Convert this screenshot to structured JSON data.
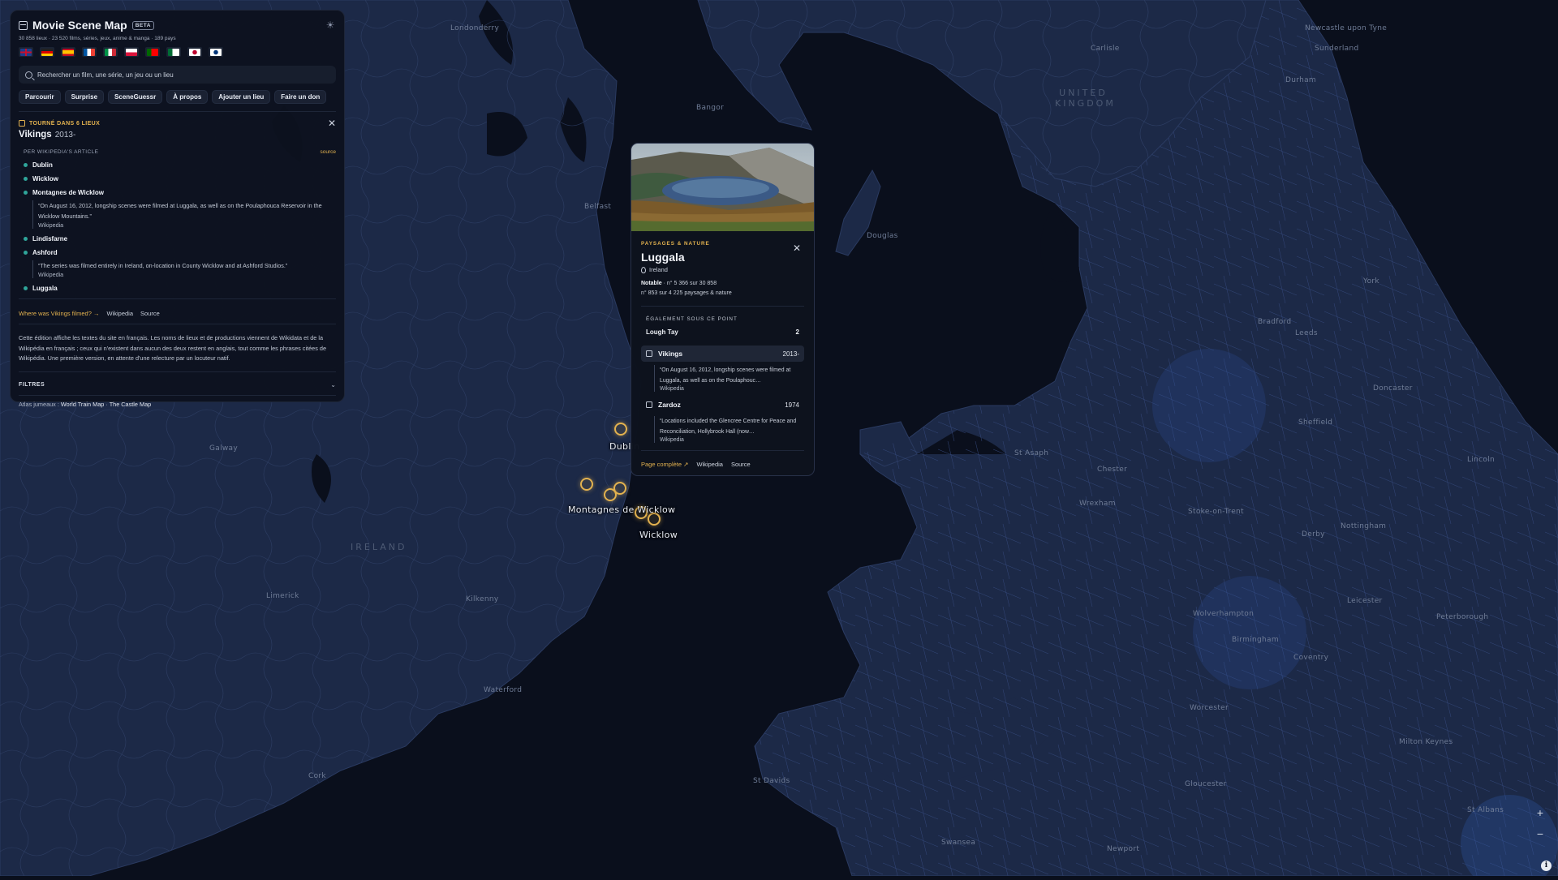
{
  "app": {
    "title": "Movie Scene Map",
    "badge": "BETA",
    "stats": "30 858 lieux · 23 520 films, séries, jeux, anime & manga · 189 pays",
    "theme_icon": "sun-icon"
  },
  "search": {
    "placeholder": "Rechercher un film, une série, un jeu ou un lieu"
  },
  "nav": [
    "Parcourir",
    "Surprise",
    "SceneGuessr",
    "À propos",
    "Ajouter un lieu",
    "Faire un don"
  ],
  "languages": [
    {
      "code": "en",
      "colors": [
        "#1f3e8c",
        "#c8102e"
      ]
    },
    {
      "code": "de",
      "colors": [
        "#222222",
        "#dd0000",
        "#ffce00"
      ]
    },
    {
      "code": "es",
      "colors": [
        "#c60b1e",
        "#ffc400"
      ]
    },
    {
      "code": "fr",
      "colors": [
        "#0055a4",
        "#ffffff",
        "#ef4135"
      ]
    },
    {
      "code": "it",
      "colors": [
        "#009246",
        "#ffffff",
        "#ce2b37"
      ]
    },
    {
      "code": "pl",
      "colors": [
        "#ffffff",
        "#dc143c"
      ]
    },
    {
      "code": "pt",
      "colors": [
        "#006600",
        "#ff0000"
      ]
    },
    {
      "code": "ar",
      "colors": [
        "#006c35",
        "#ffffff"
      ]
    },
    {
      "code": "ja",
      "colors": [
        "#ffffff",
        "#bc002d"
      ]
    },
    {
      "code": "ko",
      "colors": [
        "#ffffff",
        "#003478"
      ]
    }
  ],
  "filming": {
    "header": "TOURNÉ DANS 6 LIEUX",
    "title": "Vikings",
    "year": "2013-",
    "section_title": "PER WIKIPEDIA'S ARTICLE",
    "section_link": "source",
    "locations": [
      {
        "name": "Dublin"
      },
      {
        "name": "Wicklow"
      },
      {
        "name": "Montagnes de Wicklow",
        "quote": "“On August 16, 2012, longship scenes were filmed at Luggala, as well as on the Poulaphouca Reservoir in the Wicklow Mountains.”",
        "source": "Wikipedia"
      },
      {
        "name": "Lindisfarne"
      },
      {
        "name": "Ashford",
        "quote": "“The series was filmed entirely in Ireland, on-location in County Wicklow and at Ashford Studios.”",
        "source": "Wikipedia"
      },
      {
        "name": "Luggala"
      }
    ],
    "links": {
      "where": "Where was Vikings filmed? →",
      "wikipedia": "Wikipedia",
      "source": "Source"
    },
    "description": "Cette édition affiche les textes du site en français. Les noms de lieux et de productions viennent de Wikidata et de la Wikipédia en français ; ceux qui n'existent dans aucun des deux restent en anglais, tout comme les phrases citées de Wikipédia. Une première version, en attente d'une relecture par un locuteur natif.",
    "filters_label": "FILTRES",
    "twins_prefix": "Atlas jumeaux :",
    "twins": [
      "World Train Map",
      "The Castle Map"
    ]
  },
  "popup": {
    "category": "PAYSAGES & NATURE",
    "title": "Luggala",
    "country": "Ireland",
    "rank_label": "Notable",
    "rank_overall": "n° 5 366 sur 30 858",
    "rank_category": "n° 853 sur 4 225 paysages & nature",
    "also_title": "ÉGALEMENT SOUS CE POINT",
    "also_name": "Lough Tay",
    "also_count": "2",
    "works": [
      {
        "title": "Vikings",
        "year": "2013-",
        "icon": "tv-icon",
        "quote": "“On August 16, 2012, longship scenes were filmed at Luggala, as well as on the Poulaphouc…",
        "source": "Wikipedia"
      },
      {
        "title": "Zardoz",
        "year": "1974",
        "icon": "film-icon",
        "quote": "“Locations included the Glencree Centre for Peace and Reconciliation, Hollybrook Hall (now…",
        "source": "Wikipedia"
      }
    ],
    "links": {
      "full": "Page complète",
      "wikipedia": "Wikipedia",
      "source": "Source"
    }
  },
  "map": {
    "labels": {
      "ireland": "IRELAND",
      "uk": "UNITED KINGDOM",
      "dublin_marker": "Dublin",
      "wicklow_mountains": "Montagnes de Wicklow",
      "wicklow": "Wicklow",
      "places": [
        "Londonderry",
        "Belfast",
        "Bangor",
        "Douglas",
        "Carlisle",
        "Newcastle upon Tyne",
        "Sunderland",
        "Durham",
        "York",
        "Bradford",
        "Leeds",
        "Doncaster",
        "Sheffield",
        "Lincoln",
        "Chester",
        "Wrexham",
        "Stoke-on-Trent",
        "Nottingham",
        "Derby",
        "Leicester",
        "Peterborough",
        "Birmingham",
        "Wolverhampton",
        "Coventry",
        "Worcester",
        "Milton Keynes",
        "Gloucester",
        "Newport",
        "Swansea",
        "St Davids",
        "St Asaph",
        "Galway",
        "Limerick",
        "Kilkenny",
        "Waterford",
        "Cork",
        "St Albans"
      ]
    },
    "colors": {
      "sea": "#0a0f1c",
      "land": "#1c2947",
      "marker": "#e3b24f",
      "accent_teal": "#2fa59a"
    }
  },
  "zoom": {
    "in": "+",
    "out": "−",
    "info": "i"
  }
}
